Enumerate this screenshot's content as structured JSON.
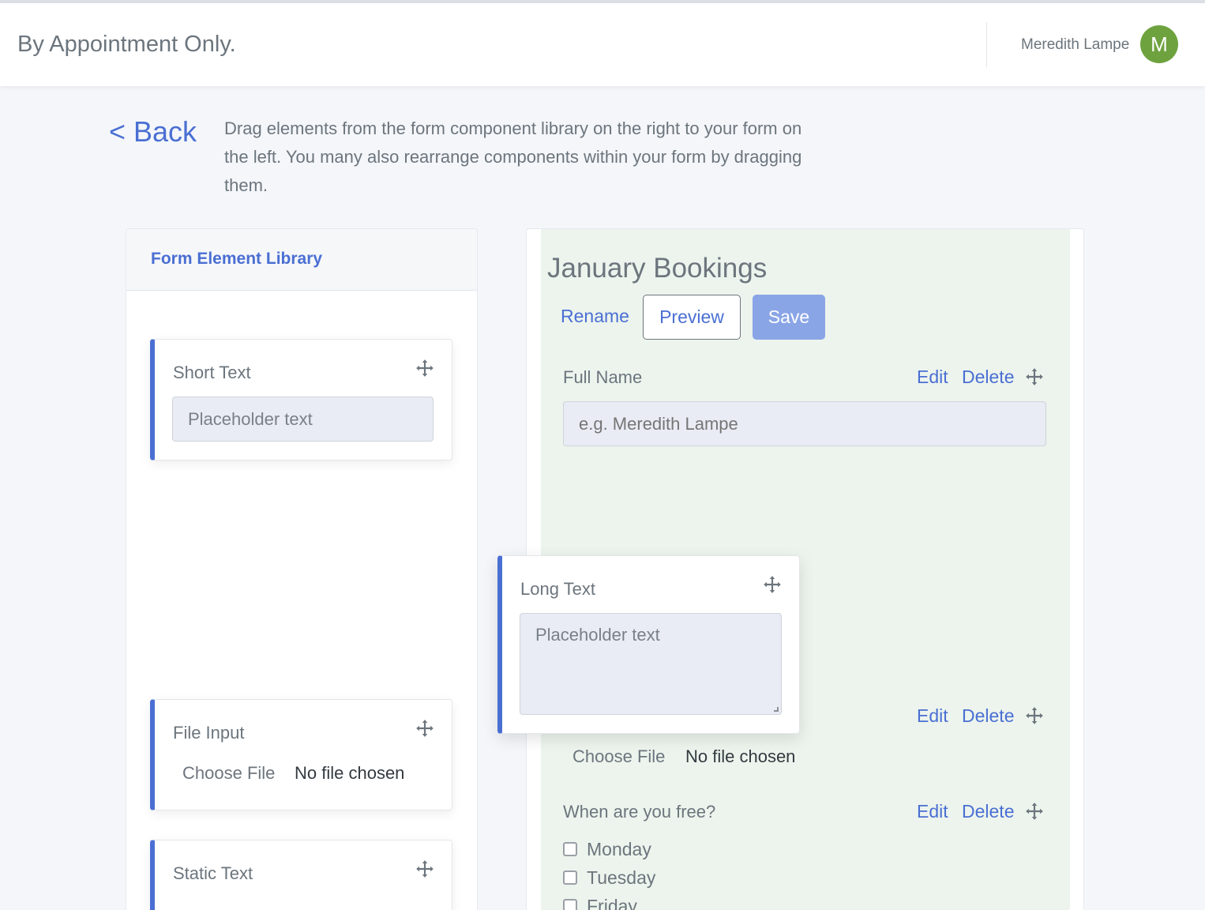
{
  "header": {
    "brand": "By Appointment Only.",
    "user_name": "Meredith Lampe",
    "avatar_initial": "M",
    "avatar_color": "#6ea23e"
  },
  "back_label": "< Back",
  "instructions": "Drag elements from the form component library on the right to your form on the left. You many also rearrange components within your form by dragging them.",
  "library": {
    "title": "Form Element Library",
    "items": [
      {
        "title": "Short Text",
        "placeholder": "Placeholder text"
      },
      {
        "title": "File Input",
        "file_button": "Choose File",
        "file_status": "No file chosen"
      },
      {
        "title": "Static Text"
      }
    ]
  },
  "dragging": {
    "title": "Long Text",
    "placeholder": "Placeholder text"
  },
  "form": {
    "title": "January Bookings",
    "rename_label": "Rename",
    "preview_label": "Preview",
    "save_label": "Save",
    "fields": [
      {
        "label": "Full Name",
        "placeholder": "e.g. Meredith Lampe",
        "edit": "Edit",
        "delete": "Delete"
      },
      {
        "file_button": "Choose File",
        "file_status": "No file chosen",
        "edit": "Edit",
        "delete": "Delete"
      },
      {
        "label": "When are you free?",
        "edit": "Edit",
        "delete": "Delete",
        "options": [
          "Monday",
          "Tuesday",
          "Friday"
        ]
      }
    ]
  },
  "colors": {
    "accent": "#4a6fd3",
    "save_button": "#8aa5e6",
    "form_background": "#edf4ed"
  }
}
